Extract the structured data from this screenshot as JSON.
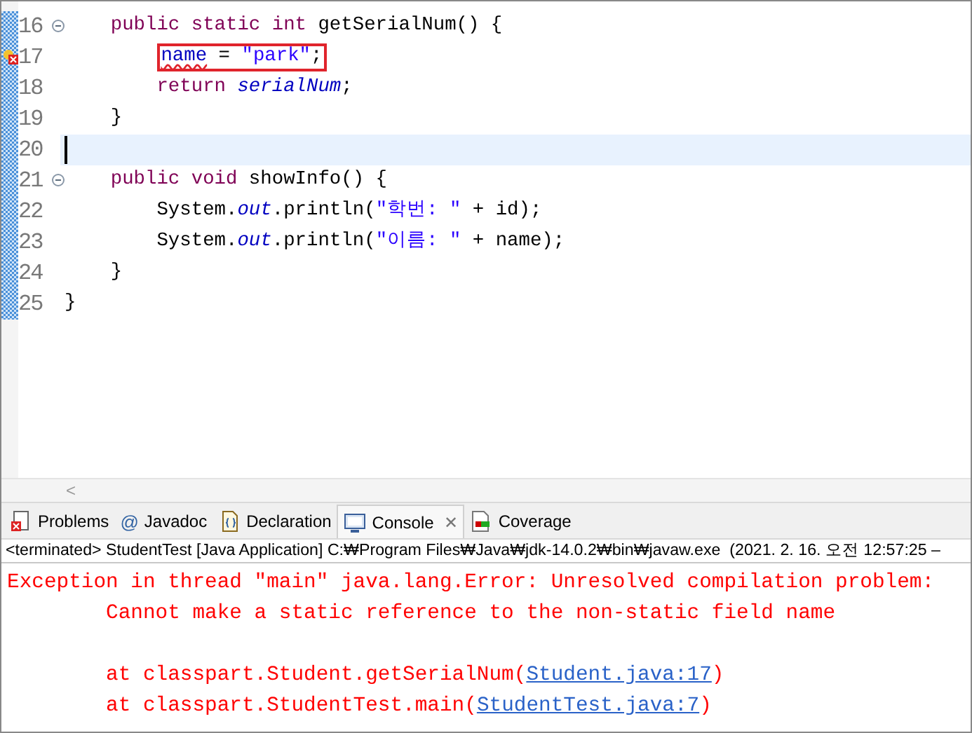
{
  "editor": {
    "lines": [
      {
        "number": "16",
        "foldable": true,
        "error": false,
        "current": false,
        "boxed": false,
        "tokens": [
          {
            "text": "    public static int",
            "kind": "keyword"
          },
          {
            "text": " getSerialNum() {",
            "kind": "plain"
          }
        ]
      },
      {
        "number": "17",
        "foldable": false,
        "error": true,
        "current": false,
        "boxed": true,
        "tokens": [
          {
            "text": "        name",
            "kind": "error-field"
          },
          {
            "text": " = ",
            "kind": "plain"
          },
          {
            "text": "\"park\"",
            "kind": "string"
          },
          {
            "text": ";",
            "kind": "plain"
          }
        ]
      },
      {
        "number": "18",
        "foldable": false,
        "error": false,
        "current": false,
        "boxed": false,
        "tokens": [
          {
            "text": "        return ",
            "kind": "keyword"
          },
          {
            "text": "serialNum",
            "kind": "static-field"
          },
          {
            "text": ";",
            "kind": "plain"
          }
        ]
      },
      {
        "number": "19",
        "foldable": false,
        "error": false,
        "current": false,
        "boxed": false,
        "tokens": [
          {
            "text": "    }",
            "kind": "plain"
          }
        ]
      },
      {
        "number": "20",
        "foldable": false,
        "error": false,
        "current": true,
        "boxed": false
      },
      {
        "number": "21",
        "foldable": true,
        "error": false,
        "current": false,
        "boxed": false,
        "tokens": [
          {
            "text": "    public void",
            "kind": "keyword"
          },
          {
            "text": " showInfo() {",
            "kind": "plain"
          }
        ]
      },
      {
        "number": "22",
        "foldable": false,
        "error": false,
        "current": false,
        "boxed": false,
        "tokens": [
          {
            "text": "        System.",
            "kind": "plain"
          },
          {
            "text": "out",
            "kind": "static-field"
          },
          {
            "text": ".println(",
            "kind": "plain"
          },
          {
            "text": "\"학번: \"",
            "kind": "string"
          },
          {
            "text": " + id);",
            "kind": "plain"
          }
        ]
      },
      {
        "number": "23",
        "foldable": false,
        "error": false,
        "current": false,
        "boxed": false,
        "tokens": [
          {
            "text": "        System.",
            "kind": "plain"
          },
          {
            "text": "out",
            "kind": "static-field"
          },
          {
            "text": ".println(",
            "kind": "plain"
          },
          {
            "text": "\"이름: \"",
            "kind": "string"
          },
          {
            "text": " + name);",
            "kind": "plain"
          }
        ]
      },
      {
        "number": "24",
        "foldable": false,
        "error": false,
        "current": false,
        "boxed": false,
        "tokens": [
          {
            "text": "    }",
            "kind": "plain"
          }
        ]
      },
      {
        "number": "25",
        "foldable": false,
        "error": false,
        "current": false,
        "boxed": false,
        "tokens": [
          {
            "text": "}",
            "kind": "plain"
          }
        ]
      }
    ]
  },
  "scroll_left_arrow": "<",
  "tabs": [
    {
      "label": "Problems",
      "kind": "problems",
      "selected": false
    },
    {
      "label": "Javadoc",
      "kind": "javadoc",
      "icon_char": "@",
      "selected": false
    },
    {
      "label": "Declaration",
      "kind": "declaration",
      "selected": false
    },
    {
      "label": "Console",
      "kind": "console",
      "selected": true,
      "close_symbol": "✕"
    },
    {
      "label": "Coverage",
      "kind": "coverage",
      "selected": false
    }
  ],
  "console": {
    "header": "<terminated> StudentTest [Java Application] C:₩Program Files₩Java₩jdk-14.0.2₩bin₩javaw.exe  (2021. 2. 16. 오전 12:57:25 –",
    "blocks": [
      [
        [
          {
            "text": "Exception in thread \"main\" java.lang.Error: Unresolved compilation problem: ",
            "kind": "error"
          }
        ],
        [
          {
            "text": "\tCannot make a static reference to the non-static field name",
            "kind": "error"
          }
        ]
      ],
      [
        [
          {
            "text": "\tat classpart.Student.getSerialNum(",
            "kind": "error"
          },
          {
            "text": "Student.java:17",
            "kind": "link"
          },
          {
            "text": ")",
            "kind": "error"
          }
        ],
        [
          {
            "text": "\tat classpart.StudentTest.main(",
            "kind": "error"
          },
          {
            "text": "StudentTest.java:7",
            "kind": "link"
          },
          {
            "text": ")",
            "kind": "error"
          }
        ]
      ]
    ]
  }
}
